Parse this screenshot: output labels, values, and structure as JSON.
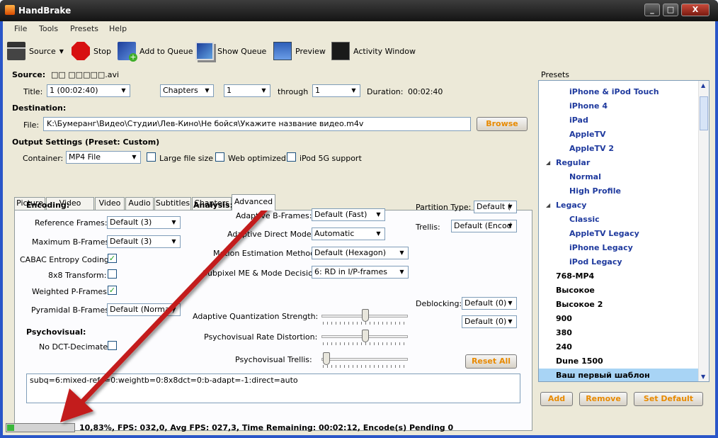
{
  "window": {
    "title": "HandBrake",
    "buttons": [
      "_",
      "□",
      "X"
    ]
  },
  "menu": [
    "File",
    "Tools",
    "Presets",
    "Help"
  ],
  "toolbar": {
    "source": "Source",
    "stop": "Stop",
    "add_to_queue": "Add to Queue",
    "show_queue": "Show Queue",
    "preview": "Preview",
    "activity_window": "Activity Window"
  },
  "source": {
    "label": "Source:",
    "value": "□□ □□□□□.avi",
    "title_label": "Title:",
    "title_value": "1 (00:02:40)",
    "range_type": "Chapters",
    "range_start": "1",
    "through_label": "through",
    "range_end": "1",
    "duration_label": "Duration:",
    "duration_value": "00:02:40"
  },
  "destination": {
    "heading": "Destination:",
    "file_label": "File:",
    "file_value": "K:\\Бумеранг\\Видео\\Студии\\Лев-Кино\\Не бойся\\Укажите название видео.m4v",
    "browse": "Browse"
  },
  "output": {
    "heading": "Output Settings (Preset: Custom)",
    "container_label": "Container:",
    "container_value": "MP4 File",
    "large_file": "Large file size",
    "web_optimized": "Web optimized",
    "ipod": "iPod 5G support"
  },
  "tabs": [
    "Picture",
    "Video Filters",
    "Video",
    "Audio",
    "Subtitles",
    "Chapters",
    "Advanced"
  ],
  "advanced": {
    "encoding_heading": "Encoding:",
    "ref_frames_label": "Reference Frames:",
    "ref_frames_value": "Default (3)",
    "max_bframes_label": "Maximum B-Frames:",
    "max_bframes_value": "Default (3)",
    "cabac_label": "CABAC Entropy Coding:",
    "t8x8_label": "8x8 Transform:",
    "weighted_label": "Weighted P-Frames:",
    "pyramidal_label": "Pyramidal B-Frames:",
    "pyramidal_value": "Default (Normal)",
    "psycho_heading": "Psychovisual:",
    "no_dct_label": "No DCT-Decimate:",
    "analysis_heading": "Analysis:",
    "adaptive_bframes_label": "Adaptive B-Frames:",
    "adaptive_bframes_value": "Default (Fast)",
    "direct_mode_label": "Adaptive Direct Mode:",
    "direct_mode_value": "Automatic",
    "motion_label": "Motion Estimation Method:",
    "motion_value": "Default (Hexagon)",
    "subpixel_label": "Subpixel ME & Mode Decision:",
    "subpixel_value": "6: RD in I/P-frames",
    "partition_label": "Partition Type:",
    "partition_value": "Default (",
    "trellis_label": "Trellis:",
    "trellis_value": "Default (Encod",
    "deblocking_label": "Deblocking:",
    "deblock1_value": "Default (0)",
    "deblock2_value": "Default (0)",
    "aq_label": "Adaptive Quantization Strength:",
    "prd_label": "Psychovisual Rate Distortion:",
    "ptrellis_label": "Psychovisual Trellis:",
    "reset_all": "Reset All",
    "option_string": "subq=6:mixed-refs=0:weightb=0:8x8dct=0:b-adapt=-1:direct=auto",
    "aq_level": 0.5,
    "prd_level": 0.5,
    "ptrellis_level": 0.0
  },
  "presets": {
    "heading": "Presets",
    "items": [
      {
        "label": "iPhone & iPod Touch",
        "kind": "child"
      },
      {
        "label": "iPhone 4",
        "kind": "child"
      },
      {
        "label": "iPad",
        "kind": "child"
      },
      {
        "label": "AppleTV",
        "kind": "child"
      },
      {
        "label": "AppleTV 2",
        "kind": "child"
      },
      {
        "label": "Regular",
        "kind": "group"
      },
      {
        "label": "Normal",
        "kind": "child"
      },
      {
        "label": "High Profile",
        "kind": "child"
      },
      {
        "label": "Legacy",
        "kind": "group"
      },
      {
        "label": "Classic",
        "kind": "child"
      },
      {
        "label": "AppleTV Legacy",
        "kind": "child"
      },
      {
        "label": "iPhone Legacy",
        "kind": "child"
      },
      {
        "label": "iPod Legacy",
        "kind": "child"
      },
      {
        "label": "768-MP4",
        "kind": "top"
      },
      {
        "label": "Высокое",
        "kind": "top"
      },
      {
        "label": "Высокое 2",
        "kind": "top"
      },
      {
        "label": "900",
        "kind": "top"
      },
      {
        "label": "380",
        "kind": "top"
      },
      {
        "label": "240",
        "kind": "top"
      },
      {
        "label": "Dune 1500",
        "kind": "top"
      },
      {
        "label": "Ваш первый шаблон",
        "kind": "top",
        "selected": true
      }
    ],
    "add": "Add",
    "remove": "Remove",
    "set_default": "Set Default"
  },
  "status": {
    "text": "10,83%,  FPS: 032,0,  Avg FPS: 027,3,  Time Remaining: 00:02:12,  Encode(s) Pending 0",
    "progress": 0.1083
  },
  "colors": {
    "title_bg": "#1e1e1e",
    "frame": "#2a56c8",
    "dialog": "#ece9d8",
    "accent_orange": "#e88a00",
    "arrow": "#c31c1c"
  }
}
